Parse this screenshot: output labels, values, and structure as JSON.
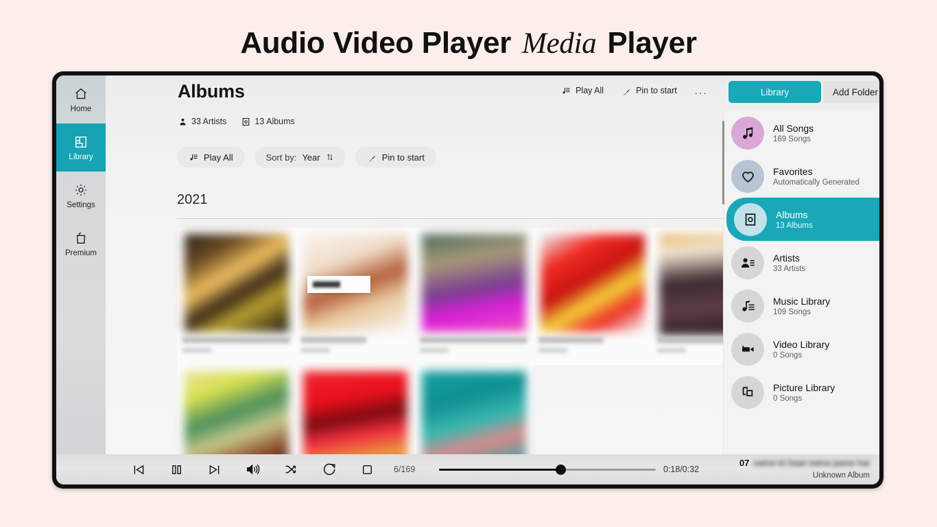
{
  "header_title": {
    "part1": "Audio Video Player",
    "italic": "Media",
    "part2": "Player"
  },
  "colors": {
    "accent_teal": "#1aa8b8",
    "page_background": "#fbeeeb",
    "bezel": "#111111",
    "all_songs_circle": "#d9a8d8",
    "favorites_circle": "#b7c4d4"
  },
  "rail": {
    "items": [
      {
        "label": "Home",
        "icon": "home-icon",
        "active": false
      },
      {
        "label": "Library",
        "icon": "library-grid-icon",
        "active": true
      },
      {
        "label": "Settings",
        "icon": "gear-icon",
        "active": false
      },
      {
        "label": "Premium",
        "icon": "shopping-bag-icon",
        "active": false
      }
    ]
  },
  "content_header": {
    "title": "Albums",
    "meta": [
      {
        "label": "33 Artists",
        "icon": "person-icon"
      },
      {
        "label": "13 Albums",
        "icon": "album-icon"
      }
    ],
    "actions": [
      {
        "label": "Play All",
        "icon": "play-all-icon"
      },
      {
        "label": "Pin to start",
        "icon": "pin-icon"
      }
    ],
    "overflow": "...",
    "tab_library": "Library",
    "button_add_folder": "Add Folder"
  },
  "toolbar_pills": [
    {
      "label": "Play All",
      "icon": "play-all-icon"
    },
    {
      "label": "Sort by:",
      "value": "Year",
      "icon": "sort-arrows-icon"
    },
    {
      "label": "Pin to start",
      "icon": "pin-icon"
    }
  ],
  "album_group": {
    "year": "2021"
  },
  "albums": [
    {
      "art_css": "linear-gradient(150deg,#2a2018 0%,#6b4a22 22%,#f0c060 42%,#3b2a18 58%,#b9a030 72%,#1b140e 100%)"
    },
    {
      "art_css": "linear-gradient(160deg,#f7f3ef 0%,#f0dcc8 30%,#b4603a 52%,#e8c79e 70%,#faf7f4 100%)"
    },
    {
      "art_css": "linear-gradient(170deg,#4c6a5a 0%,#a89878 28%,#7a3f8f 55%,#d81fd8 74%,#f050c0 100%)"
    },
    {
      "art_css": "linear-gradient(150deg,#eef4f5 0%,#ef2a22 25%,#c81410 46%,#f3d23a 62%,#ee2f28 78%,#f7fbfb 100%)"
    },
    {
      "art_css": "linear-gradient(175deg,#e8b96a 0%,#f2e7d4 18%,#3a2a30 46%,#5c3e44 70%,#2a1c20 100%)"
    },
    {
      "art_css": "linear-gradient(160deg,#e8e49a 0%,#d8e050 22%,#4c8f5c 44%,#c8c88a 62%,#8a4a2a 82%,#40243a 100%)"
    },
    {
      "art_css": "linear-gradient(170deg,#ef2430 0%,#e8101c 30%,#7a0a10 48%,#f23040 64%,#e8a840 86%,#d81c28 100%)"
    },
    {
      "art_css": "linear-gradient(165deg,#14a0a0 0%,#0f8f92 30%,#3ab8b0 52%,#d88a8a 70%,#18a8a8 100%)"
    }
  ],
  "library_panel": {
    "items": [
      {
        "title": "All Songs",
        "subtitle": "169 Songs",
        "icon": "music-note-icon",
        "active": false,
        "circle": "#d9a8d8"
      },
      {
        "title": "Favorites",
        "subtitle": "Automatically Generated",
        "icon": "heart-icon",
        "active": false,
        "circle": "#b7c4d4"
      },
      {
        "title": "Albums",
        "subtitle": "13 Albums",
        "icon": "album-icon",
        "active": true,
        "circle": "#bfe3e8"
      },
      {
        "title": "Artists",
        "subtitle": "33 Artists",
        "icon": "artist-icon",
        "active": false,
        "circle": "#d6d6d6"
      },
      {
        "title": "Music Library",
        "subtitle": "109 Songs",
        "icon": "music-list-icon",
        "active": false,
        "circle": "#d6d6d6"
      },
      {
        "title": "Video Library",
        "subtitle": "0 Songs",
        "icon": "video-camera-icon",
        "active": false,
        "circle": "#d6d6d6"
      },
      {
        "title": "Picture Library",
        "subtitle": "0 Songs",
        "icon": "pictures-icon",
        "active": false,
        "circle": "#d6d6d6"
      }
    ]
  },
  "player": {
    "controls": [
      {
        "name": "previous-track-button",
        "icon": "skip-back-icon"
      },
      {
        "name": "pause-button",
        "icon": "pause-icon"
      },
      {
        "name": "next-track-button",
        "icon": "skip-forward-icon"
      },
      {
        "name": "volume-button",
        "icon": "speaker-icon"
      },
      {
        "name": "shuffle-button",
        "icon": "shuffle-icon"
      },
      {
        "name": "repeat-button",
        "icon": "repeat-icon"
      },
      {
        "name": "stop-button",
        "icon": "stop-square-icon"
      }
    ],
    "track_counter": "6/169",
    "time": "0:18/0:32",
    "progress_percent": 56,
    "now_playing": {
      "number": "07",
      "title": "naino ki baat naina jaane hai",
      "album": "Unknown Album"
    }
  }
}
